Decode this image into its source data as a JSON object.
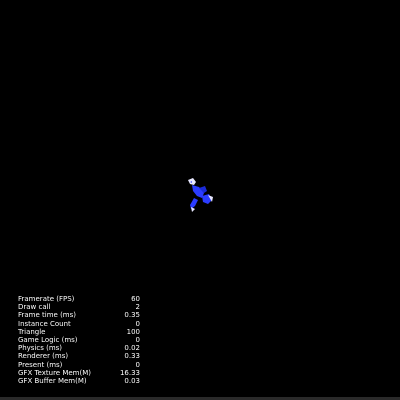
{
  "stats": [
    {
      "label": "Framerate (FPS)",
      "value": "60"
    },
    {
      "label": "Draw call",
      "value": "2"
    },
    {
      "label": "Frame time (ms)",
      "value": "0.35"
    },
    {
      "label": "Instance Count",
      "value": "0"
    },
    {
      "label": "Triangle",
      "value": "100"
    },
    {
      "label": "Game Logic (ms)",
      "value": "0"
    },
    {
      "label": "Physics (ms)",
      "value": "0.02"
    },
    {
      "label": "Renderer (ms)",
      "value": "0.33"
    },
    {
      "label": "Present (ms)",
      "value": "0"
    },
    {
      "label": "GFX Texture Mem(M)",
      "value": "16.33"
    },
    {
      "label": "GFX Buffer Mem(M)",
      "value": "0.03"
    }
  ],
  "colors": {
    "background": "#000000",
    "stats_text": "#ffffff",
    "sprite_primary": "#2b3cff",
    "sprite_secondary": "#e8e8ff"
  },
  "sprite": {
    "icon": "character-sprite-icon"
  }
}
